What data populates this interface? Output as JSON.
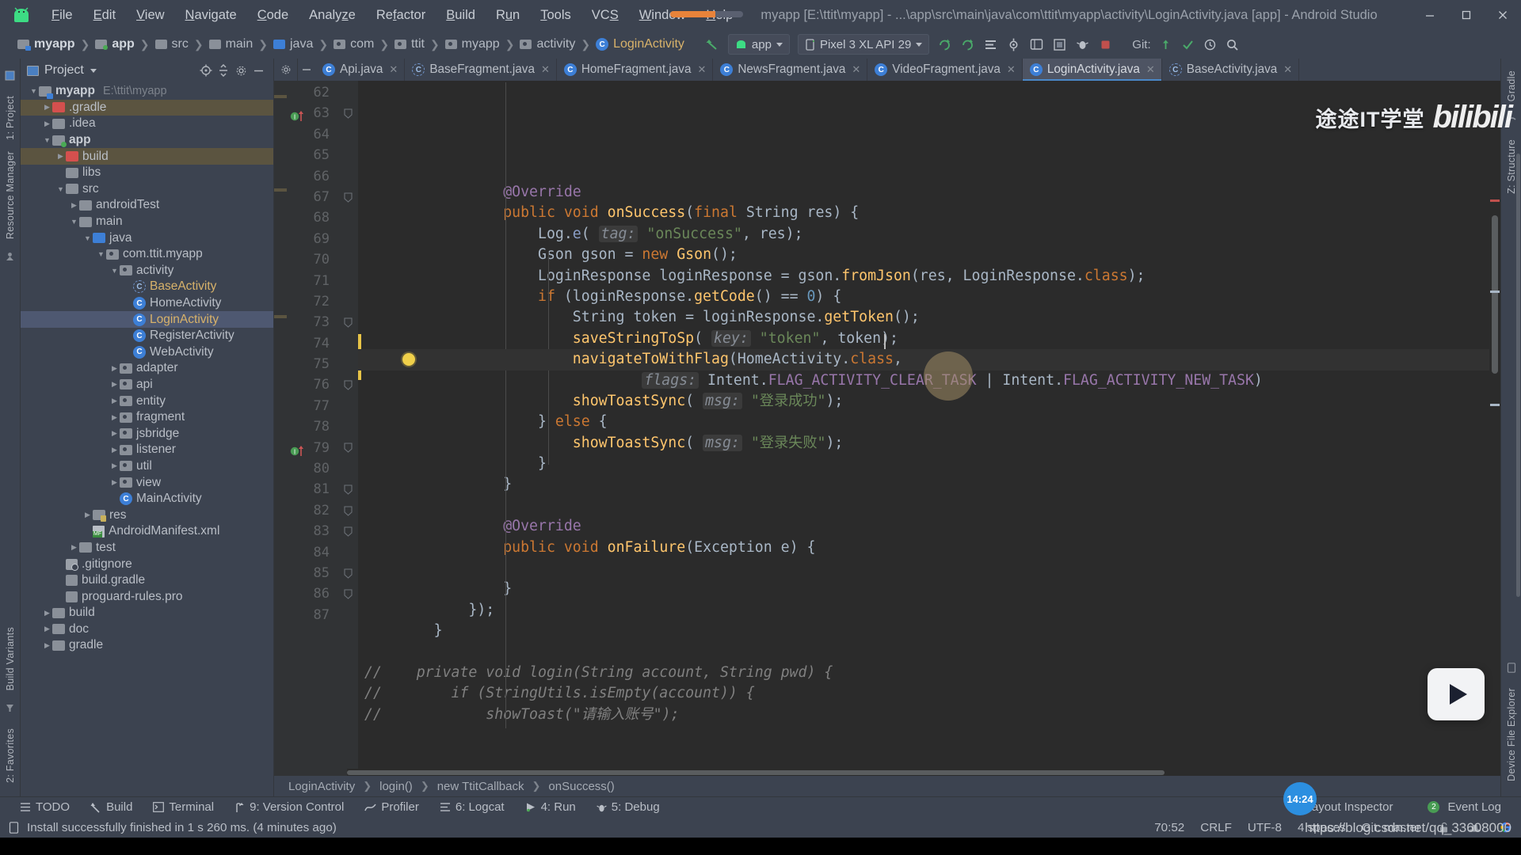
{
  "window": {
    "title": "myapp [E:\\ttit\\myapp] - ...\\app\\src\\main\\java\\com\\ttit\\myapp\\activity\\LoginActivity.java [app] - Android Studio",
    "minimize": "—",
    "maximize": "❐",
    "close": "✕"
  },
  "menu": [
    "File",
    "Edit",
    "View",
    "Navigate",
    "Code",
    "Analyze",
    "Refactor",
    "Build",
    "Run",
    "Tools",
    "VCS",
    "Window",
    "Help"
  ],
  "breadcrumb": [
    {
      "label": "myapp",
      "icon": "module-folder-icon",
      "kind": "myapp"
    },
    {
      "label": "app",
      "icon": "module-folder-icon",
      "kind": "mod"
    },
    {
      "label": "src",
      "icon": "folder-icon",
      "kind": "plain"
    },
    {
      "label": "main",
      "icon": "folder-icon",
      "kind": "plain"
    },
    {
      "label": "java",
      "icon": "source-folder-icon",
      "kind": "blue"
    },
    {
      "label": "com",
      "icon": "package-icon",
      "kind": "pkg"
    },
    {
      "label": "ttit",
      "icon": "package-icon",
      "kind": "pkg"
    },
    {
      "label": "myapp",
      "icon": "package-icon",
      "kind": "pkg"
    },
    {
      "label": "activity",
      "icon": "package-icon",
      "kind": "pkg"
    },
    {
      "label": "LoginActivity",
      "icon": "java-class-icon",
      "kind": "class"
    }
  ],
  "toolbar": {
    "back_icon": "back-arrow-icon",
    "run_config": "app",
    "device": "Pixel 3 XL API 29",
    "git_label": "Git:",
    "icons": [
      "sync-icon",
      "refresh-icon",
      "avd-manager-icon",
      "sdk-manager-icon",
      "layout-inspector-icon",
      "profiler-icon",
      "attach-debugger-icon",
      "stop-icon",
      "search-icon"
    ]
  },
  "project_panel": {
    "title": "Project",
    "locate_icon": "locate-icon",
    "collapse_icon": "collapse-all-icon",
    "settings_icon": "gear-icon",
    "hide_icon": "hide-icon",
    "tree": [
      {
        "label": "myapp",
        "path": "E:\\ttit\\myapp",
        "indent": 0,
        "arrow": "down",
        "icon": "myapp-root-folder-icon",
        "style": "bold"
      },
      {
        "label": ".gradle",
        "indent": 1,
        "arrow": "right",
        "icon": "excluded-folder-icon",
        "style": "excluded"
      },
      {
        "label": ".idea",
        "indent": 1,
        "arrow": "right",
        "icon": "folder-icon",
        "style": ""
      },
      {
        "label": "app",
        "indent": 1,
        "arrow": "down",
        "icon": "module-folder-icon",
        "style": "bold"
      },
      {
        "label": "build",
        "indent": 2,
        "arrow": "right",
        "icon": "excluded-folder-icon",
        "style": "excluded"
      },
      {
        "label": "libs",
        "indent": 2,
        "arrow": "none",
        "icon": "folder-icon",
        "style": ""
      },
      {
        "label": "src",
        "indent": 2,
        "arrow": "down",
        "icon": "folder-icon",
        "style": ""
      },
      {
        "label": "androidTest",
        "indent": 3,
        "arrow": "right",
        "icon": "folder-icon",
        "style": ""
      },
      {
        "label": "main",
        "indent": 3,
        "arrow": "down",
        "icon": "folder-icon",
        "style": ""
      },
      {
        "label": "java",
        "indent": 4,
        "arrow": "down",
        "icon": "source-folder-icon",
        "style": ""
      },
      {
        "label": "com.ttit.myapp",
        "indent": 5,
        "arrow": "down",
        "icon": "package-icon",
        "style": ""
      },
      {
        "label": "activity",
        "indent": 6,
        "arrow": "down",
        "icon": "package-icon",
        "style": ""
      },
      {
        "label": "BaseActivity",
        "indent": 7,
        "arrow": "none",
        "icon": "abstract-class-icon",
        "style": "class"
      },
      {
        "label": "HomeActivity",
        "indent": 7,
        "arrow": "none",
        "icon": "java-class-icon",
        "style": ""
      },
      {
        "label": "LoginActivity",
        "indent": 7,
        "arrow": "none",
        "icon": "java-class-icon",
        "style": "class selected"
      },
      {
        "label": "RegisterActivity",
        "indent": 7,
        "arrow": "none",
        "icon": "java-class-icon",
        "style": ""
      },
      {
        "label": "WebActivity",
        "indent": 7,
        "arrow": "none",
        "icon": "java-class-icon",
        "style": ""
      },
      {
        "label": "adapter",
        "indent": 6,
        "arrow": "right",
        "icon": "package-icon",
        "style": ""
      },
      {
        "label": "api",
        "indent": 6,
        "arrow": "right",
        "icon": "package-icon",
        "style": ""
      },
      {
        "label": "entity",
        "indent": 6,
        "arrow": "right",
        "icon": "package-icon",
        "style": ""
      },
      {
        "label": "fragment",
        "indent": 6,
        "arrow": "right",
        "icon": "package-icon",
        "style": ""
      },
      {
        "label": "jsbridge",
        "indent": 6,
        "arrow": "right",
        "icon": "package-icon",
        "style": ""
      },
      {
        "label": "listener",
        "indent": 6,
        "arrow": "right",
        "icon": "package-icon",
        "style": ""
      },
      {
        "label": "util",
        "indent": 6,
        "arrow": "right",
        "icon": "package-icon",
        "style": ""
      },
      {
        "label": "view",
        "indent": 6,
        "arrow": "right",
        "icon": "package-icon",
        "style": ""
      },
      {
        "label": "MainActivity",
        "indent": 6,
        "arrow": "none",
        "icon": "java-class-icon",
        "style": ""
      },
      {
        "label": "res",
        "indent": 4,
        "arrow": "right",
        "icon": "res-folder-icon",
        "style": ""
      },
      {
        "label": "AndroidManifest.xml",
        "indent": 4,
        "arrow": "none",
        "icon": "manifest-icon",
        "style": ""
      },
      {
        "label": "test",
        "indent": 3,
        "arrow": "right",
        "icon": "folder-icon",
        "style": ""
      },
      {
        "label": ".gitignore",
        "indent": 2,
        "arrow": "none",
        "icon": "gitignore-icon",
        "style": ""
      },
      {
        "label": "build.gradle",
        "indent": 2,
        "arrow": "none",
        "icon": "gradle-file-icon",
        "style": ""
      },
      {
        "label": "proguard-rules.pro",
        "indent": 2,
        "arrow": "none",
        "icon": "file-icon",
        "style": ""
      },
      {
        "label": "build",
        "indent": 1,
        "arrow": "right",
        "icon": "folder-icon",
        "style": ""
      },
      {
        "label": "doc",
        "indent": 1,
        "arrow": "right",
        "icon": "folder-icon",
        "style": ""
      },
      {
        "label": "gradle",
        "indent": 1,
        "arrow": "right",
        "icon": "folder-icon",
        "style": ""
      }
    ]
  },
  "left_rail": [
    "1: Project",
    "Resource Manager",
    "Build Variants",
    "2: Favorites"
  ],
  "right_rail": [
    "Gradle",
    "Z: Structure",
    "Device File Explorer"
  ],
  "tabs": [
    {
      "label": "Api.java",
      "icon": "java-class-icon",
      "active": false
    },
    {
      "label": "BaseFragment.java",
      "icon": "abstract-class-icon",
      "active": false
    },
    {
      "label": "HomeFragment.java",
      "icon": "java-class-icon",
      "active": false
    },
    {
      "label": "NewsFragment.java",
      "icon": "java-class-icon",
      "active": false
    },
    {
      "label": "VideoFragment.java",
      "icon": "java-class-icon",
      "active": false
    },
    {
      "label": "LoginActivity.java",
      "icon": "java-class-icon",
      "active": true
    },
    {
      "label": "BaseActivity.java",
      "icon": "abstract-class-icon",
      "active": false
    }
  ],
  "editor": {
    "first_line": 62,
    "lines": [
      {
        "n": 62,
        "segments": [
          {
            "t": "                @Override",
            "c": "fld"
          }
        ]
      },
      {
        "n": 63,
        "segments": [
          {
            "t": "                ",
            "c": ""
          },
          {
            "t": "public",
            "c": "kw"
          },
          {
            "t": " ",
            "c": ""
          },
          {
            "t": "void",
            "c": "kw"
          },
          {
            "t": " ",
            "c": ""
          },
          {
            "t": "onSuccess",
            "c": "mth"
          },
          {
            "t": "(",
            "c": ""
          },
          {
            "t": "final",
            "c": "kw"
          },
          {
            "t": " String res) {",
            "c": ""
          }
        ],
        "marker": "impl-override"
      },
      {
        "n": 64,
        "segments": [
          {
            "t": "                    Log.",
            "c": ""
          },
          {
            "t": "e",
            "c": "stat"
          },
          {
            "t": "( ",
            "c": ""
          },
          {
            "t": "tag:",
            "c": "hint"
          },
          {
            "t": " ",
            "c": ""
          },
          {
            "t": "\"onSuccess\"",
            "c": "str"
          },
          {
            "t": ", res);",
            "c": ""
          }
        ]
      },
      {
        "n": 65,
        "segments": [
          {
            "t": "                    Gson gson = ",
            "c": ""
          },
          {
            "t": "new",
            "c": "kw"
          },
          {
            "t": " ",
            "c": ""
          },
          {
            "t": "Gson",
            "c": "cls2"
          },
          {
            "t": "();",
            "c": ""
          }
        ]
      },
      {
        "n": 66,
        "segments": [
          {
            "t": "                    LoginResponse loginResponse = gson.",
            "c": ""
          },
          {
            "t": "fromJson",
            "c": "mth"
          },
          {
            "t": "(res, LoginResponse.",
            "c": ""
          },
          {
            "t": "class",
            "c": "kw"
          },
          {
            "t": ");",
            "c": ""
          }
        ]
      },
      {
        "n": 67,
        "segments": [
          {
            "t": "                    ",
            "c": ""
          },
          {
            "t": "if",
            "c": "kw"
          },
          {
            "t": " (loginResponse.",
            "c": ""
          },
          {
            "t": "getCode",
            "c": "mth"
          },
          {
            "t": "() == ",
            "c": ""
          },
          {
            "t": "0",
            "c": "num"
          },
          {
            "t": ") {",
            "c": ""
          }
        ]
      },
      {
        "n": 68,
        "segments": [
          {
            "t": "                        String token = loginResponse.",
            "c": ""
          },
          {
            "t": "getToken",
            "c": "mth"
          },
          {
            "t": "();",
            "c": ""
          }
        ]
      },
      {
        "n": 69,
        "segments": [
          {
            "t": "                        ",
            "c": ""
          },
          {
            "t": "saveStringToSp",
            "c": "mth"
          },
          {
            "t": "( ",
            "c": ""
          },
          {
            "t": "key:",
            "c": "hint"
          },
          {
            "t": " ",
            "c": ""
          },
          {
            "t": "\"token\"",
            "c": "str"
          },
          {
            "t": ", token);",
            "c": ""
          }
        ]
      },
      {
        "n": 70,
        "segments": [
          {
            "t": "                        ",
            "c": ""
          },
          {
            "t": "navigateToWithFlag",
            "c": "mth"
          },
          {
            "t": "(HomeActivity.",
            "c": ""
          },
          {
            "t": "class",
            "c": "kw"
          },
          {
            "t": ",",
            "c": ""
          }
        ],
        "current": true,
        "bulb": true
      },
      {
        "n": 71,
        "segments": [
          {
            "t": "                                ",
            "c": ""
          },
          {
            "t": "flags:",
            "c": "hint"
          },
          {
            "t": " Intent.",
            "c": ""
          },
          {
            "t": "FLAG_ACTIVITY_CLEAR_TASK",
            "c": "fld"
          },
          {
            "t": " | Intent.",
            "c": ""
          },
          {
            "t": "FLAG_ACTIVITY_NEW_TASK",
            "c": "fld"
          },
          {
            "t": ")",
            "c": ""
          }
        ]
      },
      {
        "n": 72,
        "segments": [
          {
            "t": "                        ",
            "c": ""
          },
          {
            "t": "showToastSync",
            "c": "mth"
          },
          {
            "t": "( ",
            "c": ""
          },
          {
            "t": "msg:",
            "c": "hint"
          },
          {
            "t": " ",
            "c": ""
          },
          {
            "t": "\"登录成功\"",
            "c": "str"
          },
          {
            "t": ");",
            "c": ""
          }
        ]
      },
      {
        "n": 73,
        "segments": [
          {
            "t": "                    } ",
            "c": ""
          },
          {
            "t": "else",
            "c": "kw"
          },
          {
            "t": " {",
            "c": ""
          }
        ]
      },
      {
        "n": 74,
        "segments": [
          {
            "t": "                        ",
            "c": ""
          },
          {
            "t": "showToastSync",
            "c": "mth"
          },
          {
            "t": "( ",
            "c": ""
          },
          {
            "t": "msg:",
            "c": "hint"
          },
          {
            "t": " ",
            "c": ""
          },
          {
            "t": "\"登录失败\"",
            "c": "str"
          },
          {
            "t": ");",
            "c": ""
          }
        ]
      },
      {
        "n": 75,
        "segments": [
          {
            "t": "                    }",
            "c": ""
          }
        ]
      },
      {
        "n": 76,
        "segments": [
          {
            "t": "                }",
            "c": ""
          }
        ]
      },
      {
        "n": 77,
        "segments": [
          {
            "t": "",
            "c": ""
          }
        ]
      },
      {
        "n": 78,
        "segments": [
          {
            "t": "                @Override",
            "c": "fld"
          }
        ]
      },
      {
        "n": 79,
        "segments": [
          {
            "t": "                ",
            "c": ""
          },
          {
            "t": "public",
            "c": "kw"
          },
          {
            "t": " ",
            "c": ""
          },
          {
            "t": "void",
            "c": "kw"
          },
          {
            "t": " ",
            "c": ""
          },
          {
            "t": "onFailure",
            "c": "mth"
          },
          {
            "t": "(Exception e) {",
            "c": ""
          }
        ],
        "marker": "impl-override"
      },
      {
        "n": 80,
        "segments": [
          {
            "t": "",
            "c": ""
          }
        ]
      },
      {
        "n": 81,
        "segments": [
          {
            "t": "                }",
            "c": ""
          }
        ]
      },
      {
        "n": 82,
        "segments": [
          {
            "t": "            });",
            "c": ""
          }
        ]
      },
      {
        "n": 83,
        "segments": [
          {
            "t": "        }",
            "c": ""
          }
        ]
      },
      {
        "n": 84,
        "segments": [
          {
            "t": "",
            "c": ""
          }
        ]
      },
      {
        "n": 85,
        "segments": [
          {
            "t": "//    private void login(String account, String pwd) {",
            "c": "cmt"
          }
        ]
      },
      {
        "n": 86,
        "segments": [
          {
            "t": "//        if (StringUtils.isEmpty(account)) {",
            "c": "cmt"
          }
        ]
      },
      {
        "n": 87,
        "segments": [
          {
            "t": "//            showToast(\"请输入账号\");",
            "c": "cmt"
          }
        ]
      }
    ],
    "breadcrumb": [
      "LoginActivity",
      "login()",
      "new TtitCallback",
      "onSuccess()"
    ]
  },
  "bottom_tools": [
    {
      "label": "TODO",
      "icon": "todo-icon",
      "mnemonic": ""
    },
    {
      "label": "Build",
      "icon": "build-icon",
      "mnemonic": ""
    },
    {
      "label": "Terminal",
      "icon": "terminal-icon",
      "mnemonic": ""
    },
    {
      "label": "9: Version Control",
      "icon": "vcs-icon",
      "mnemonic": "9"
    },
    {
      "label": "Profiler",
      "icon": "profiler-icon",
      "mnemonic": ""
    },
    {
      "label": "6: Logcat",
      "icon": "logcat-icon",
      "mnemonic": "6"
    },
    {
      "label": "4: Run",
      "icon": "run-icon",
      "mnemonic": "4"
    },
    {
      "label": "5: Debug",
      "icon": "debug-icon",
      "mnemonic": "5"
    }
  ],
  "bottom_right": [
    {
      "label": "Layout Inspector",
      "icon": "layout-inspector-icon",
      "badge": ""
    },
    {
      "label": "Event Log",
      "icon": "event-log-icon",
      "badge": "2"
    }
  ],
  "status": {
    "message": "Install successfully finished in 1 s 260 ms. (4 minutes ago)",
    "message_icon": "device-icon",
    "caret": "70:52",
    "line_sep": "CRLF",
    "encoding": "UTF-8",
    "indent": "4 spaces",
    "branch": "Git: master",
    "lock_icon": "unlock-icon",
    "inspection_icon": "inspector-hat-icon",
    "google_icon": "google-icon"
  },
  "overlay": {
    "watermark_cn": "途途IT学堂",
    "watermark_brand": "bilibili",
    "time_badge": "14:24",
    "play_icon": "play-icon",
    "url": "https://blog.csdn.net/qq_33608000"
  },
  "colors": {
    "accent": "#4a88c7",
    "orange": "#e8833a",
    "selection": "#4e5871",
    "excluded": "#5b5440",
    "editor_bg": "#2b2b2b",
    "panel_bg": "#3c4350"
  }
}
